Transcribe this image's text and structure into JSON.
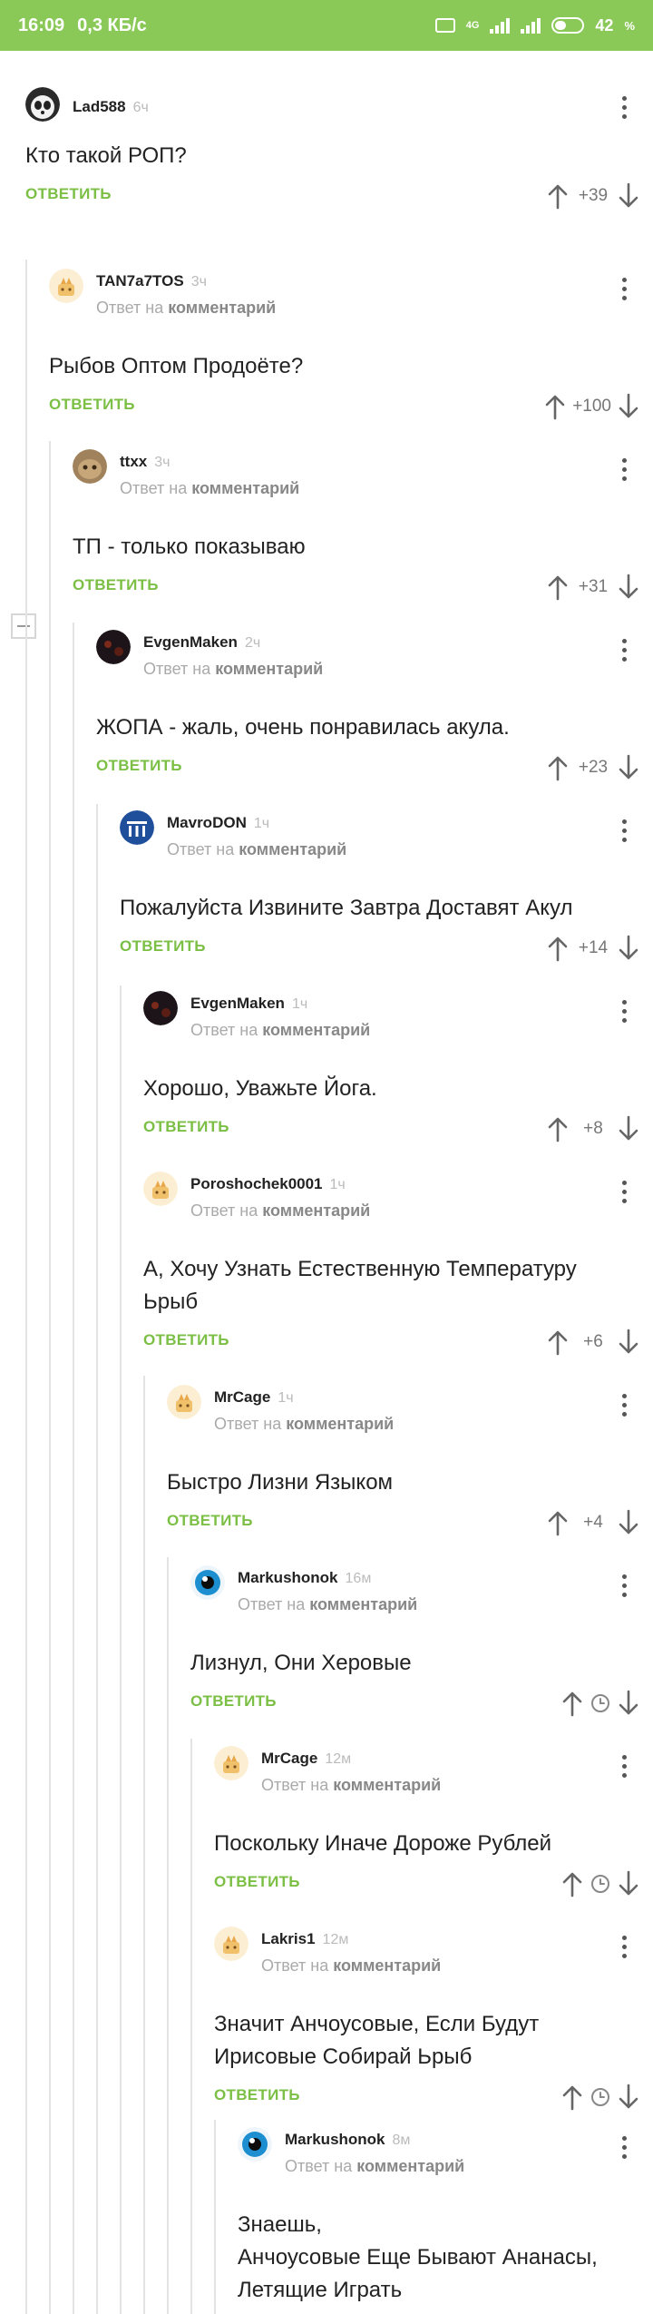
{
  "status_bar": {
    "time": "16:09",
    "speed": "0,3 КБ/с",
    "battery": "42",
    "battery_unit": "%",
    "battery_level": 0.42,
    "network": "4G"
  },
  "labels": {
    "reply_to_prefix": "Ответ на",
    "reply_to_target": "комментарий",
    "reply_button": "ОТВЕТИТЬ"
  },
  "comments": [
    {
      "author": "Lad588",
      "time": "6ч",
      "text": "Кто такой РОП?",
      "score": "+39",
      "avatar": "panda-avatar",
      "is_reply": false
    },
    {
      "author": "TAN7a7TOS",
      "time": "3ч",
      "text": "Рыбов Оптом Продоёте?",
      "score": "+100",
      "avatar": "default-avatar",
      "is_reply": true
    },
    {
      "author": "ttxx",
      "time": "3ч",
      "text": "ТП - только показываю",
      "score": "+31",
      "avatar": "cat-avatar",
      "is_reply": true
    },
    {
      "author": "EvgenMaken",
      "time": "2ч",
      "text": "ЖОПА - жаль, очень понравилась акула.",
      "score": "+23",
      "avatar": "dark-avatar",
      "is_reply": true
    },
    {
      "author": "MavroDON",
      "time": "1ч",
      "text": "Пожалуйста Извините Завтра Доставят Акул",
      "score": "+14",
      "avatar": "mmm-avatar",
      "is_reply": true
    },
    {
      "author": "EvgenMaken",
      "time": "1ч",
      "text": "Хорошо, Уважьте Йога.",
      "score": "+8",
      "avatar": "dark-avatar",
      "is_reply": true
    },
    {
      "author": "Poroshochek0001",
      "time": "1ч",
      "text": "А, Хочу Узнать Естественную Температуру\nЬрыб",
      "score": "+6",
      "avatar": "default-avatar",
      "is_reply": true
    },
    {
      "author": "MrCage",
      "time": "1ч",
      "text": "Быстро Лизни Языком",
      "score": "+4",
      "avatar": "default-avatar",
      "is_reply": true
    },
    {
      "author": "Markushonok",
      "time": "16м",
      "text": "Лизнул, Они Херовые",
      "score": "",
      "avatar": "eye-avatar",
      "is_reply": true
    },
    {
      "author": "MrCage",
      "time": "12м",
      "text": "Поскольку Иначе Дороже Рублей",
      "score": "",
      "avatar": "default-avatar",
      "is_reply": true
    },
    {
      "author": "Lakris1",
      "time": "12м",
      "text": "Значит Анчоусовые, Если Будут\nИрисовые Собирай Ьрыб",
      "score": "",
      "avatar": "default-avatar",
      "is_reply": true
    },
    {
      "author": "Markushonok",
      "time": "8м",
      "text": "Знаешь,\nАнчоусовые Еще Бывают Ананасы,\nЛетящие Играть",
      "score": "",
      "avatar": "eye-avatar",
      "is_reply": true
    }
  ],
  "colors": {
    "status_bar": "#8ac858",
    "reply_button": "#7bbf45",
    "thread_line": "#e3e3e3"
  }
}
